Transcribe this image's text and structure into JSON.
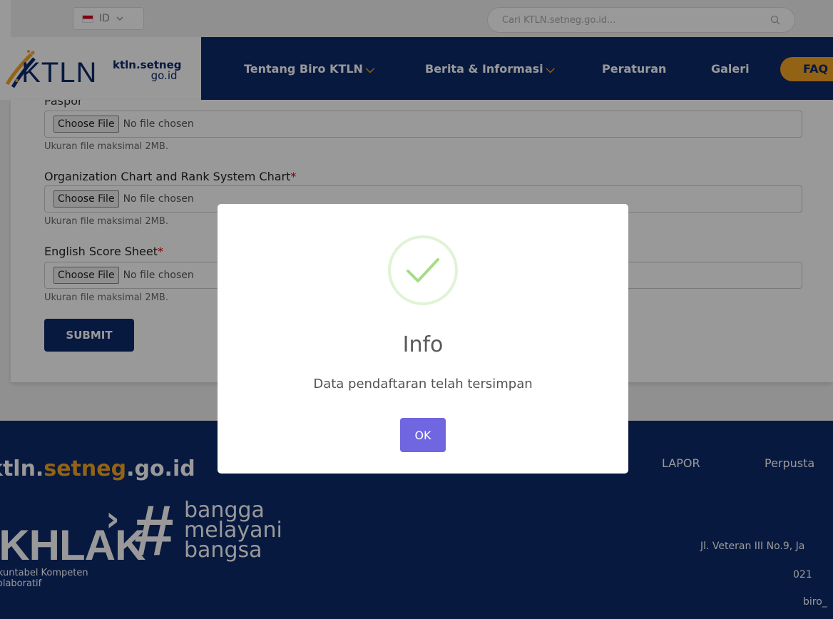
{
  "topbar": {
    "language": "ID",
    "search_placeholder": "Cari KTLN.setneg.go.id..."
  },
  "logo": {
    "brand": "KTLN",
    "site": "ktln.setneg",
    "site_tld": "go.id"
  },
  "nav": {
    "items": [
      {
        "label": "Tentang Biro KTLN",
        "has_dropdown": true
      },
      {
        "label": "Berita & Informasi",
        "has_dropdown": true
      },
      {
        "label": "Peraturan",
        "has_dropdown": false
      },
      {
        "label": "Galeri",
        "has_dropdown": false
      }
    ],
    "faq": "FAQ"
  },
  "form": {
    "cut_label": "Paspor",
    "choose_file": "Choose File",
    "no_file": "No file chosen",
    "hint": "Ukuran file maksimal 2MB.",
    "fields": [
      {
        "label": "Organization Chart and Rank System Chart",
        "required": "*"
      },
      {
        "label": "English Score Sheet",
        "required": "*"
      }
    ],
    "submit": "SUBMIT"
  },
  "footer": {
    "domain_pre": "ktln.",
    "domain_mid": "setneg",
    "domain_post": ".go.id",
    "lapor": "LAPOR",
    "perpustakaan": "Perpusta",
    "akhlak": "AKHLAK",
    "bangga": [
      "bangga",
      "melayani",
      "bangsa"
    ],
    "akhlak_values": [
      "Akuntabel Kompeten",
      "Kolaboratif"
    ],
    "address": "Jl. Veteran III No.9, Ja",
    "phone": "021",
    "email": "biro_"
  },
  "modal": {
    "title": "Info",
    "message": "Data pendaftaran telah tersimpan",
    "ok": "OK",
    "icon": "success-check-icon"
  },
  "colors": {
    "navy": "#0e2a6b",
    "accent": "#f5a623",
    "ok_button": "#7066e0",
    "success": "#a5dc86"
  }
}
